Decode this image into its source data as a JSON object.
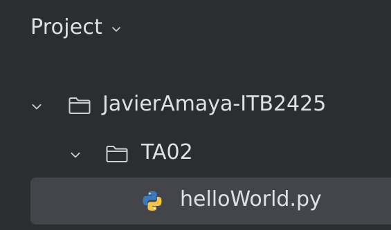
{
  "panel": {
    "title": "Project",
    "chevron_icon": "chevron-down-icon"
  },
  "tree": [
    {
      "label": "JavierAmaya-ITB2425",
      "icon": "folder-icon",
      "expanded": true,
      "level": 0
    },
    {
      "label": "TA02",
      "icon": "folder-icon",
      "expanded": true,
      "level": 1
    },
    {
      "label": "helloWorld.py",
      "icon": "python-file-icon",
      "selected": true,
      "level": 2
    }
  ],
  "colors": {
    "background": "#2b2d30",
    "selection": "#43454a",
    "text": "#dfe1e5",
    "icon_stroke": "#ced0d6",
    "python_blue": "#3d7ab8",
    "python_yellow": "#f5c542"
  }
}
